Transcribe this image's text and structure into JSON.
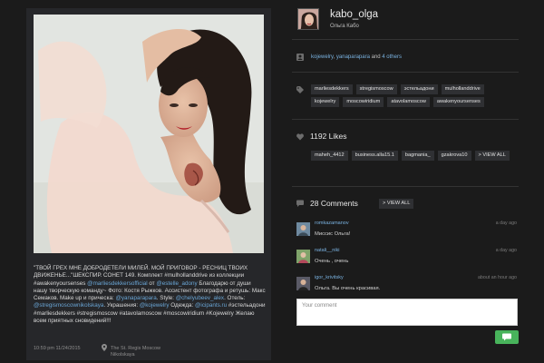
{
  "post": {
    "caption_parts": [
      {
        "t": "\"ТВОЙ ГРЕХ МНЕ ДОБРОДЕТЕЛИ МИЛЕЙ. МОЙ ПРИГОВОР - РЕСНИЦ ТВОИХ ДВИЖЕНЬЕ...\"ШЕКСПИР. СОНЕТ 149. Комплект ",
        "hl": false
      },
      {
        "t": "#mulhollanddrive",
        "hl": false
      },
      {
        "t": " из коллекции ",
        "hl": false
      },
      {
        "t": "#awakenyoursenses",
        "hl": false
      },
      {
        "t": " ",
        "hl": false
      },
      {
        "t": "@marliesdekkersofficial",
        "hl": true
      },
      {
        "t": " от ",
        "hl": false
      },
      {
        "t": "@estelle_adony",
        "hl": true
      },
      {
        "t": " Благодарю от души нашу творческую команду~ Фото: Костя Рыжков. Ассистент фотографа и ретушь: Макс Семаков. Make up и прическа: ",
        "hl": false
      },
      {
        "t": "@yanaparapara",
        "hl": true
      },
      {
        "t": ". Style: ",
        "hl": false
      },
      {
        "t": "@chelyubeev_alex",
        "hl": true
      },
      {
        "t": ". Отель: ",
        "hl": false
      },
      {
        "t": "@stregismoscownikolskaya",
        "hl": true
      },
      {
        "t": ". Украшения: ",
        "hl": false
      },
      {
        "t": "@kojewelry",
        "hl": true
      },
      {
        "t": " Одежда: ",
        "hl": false
      },
      {
        "t": "@icipants.ru",
        "hl": true
      },
      {
        "t": " #эстельадони #marliesdekkers #stregismoscow #atavolamoscow #moscowiridium #Kojewelry Желаю всем приятных сновидений!!!",
        "hl": false
      }
    ],
    "date": "10:59 pm 11/24/2015",
    "location": "The St. Regis Moscow Nikolskaya"
  },
  "profile": {
    "username": "kabo_olga",
    "full_name": "Ольга Кабо"
  },
  "tagged": {
    "users": [
      "kojewelry",
      "yanaparapara"
    ],
    "joiner": ", ",
    "and_text": " and ",
    "others": "4 others"
  },
  "hashtags": [
    "marliesdekkers",
    "stregismoscow",
    "эстельадони",
    "mulhollanddrive",
    "kojewelry",
    "moscowiridium",
    "atavolamoscow",
    "awakenyoursenses"
  ],
  "likes": {
    "count_label": "1192 Likes",
    "users": [
      "maheh_4412",
      "business.alla15.1",
      "bagmania_",
      "gzakrova10"
    ],
    "view_all": "> VIEW ALL"
  },
  "comments": {
    "count_label": "28 Comments",
    "view_all": "> VIEW ALL",
    "items": [
      {
        "user": "romkazamanov",
        "text": "Миссис Ольга!",
        "time": "a day ago"
      },
      {
        "user": "natali__niki",
        "text": "Очень , очень",
        "time": "a day ago"
      },
      {
        "user": "igor_krivitsky",
        "text": "Ольга. Вы очень красивая.",
        "time": "about an hour ago"
      }
    ],
    "input_placeholder": "Your comment"
  },
  "colors": {
    "accent_link": "#7ab2e0",
    "send_green": "#48b35b",
    "background": "#1b1b1b"
  }
}
